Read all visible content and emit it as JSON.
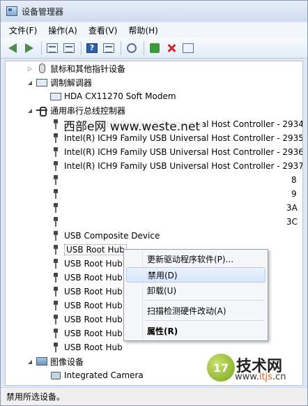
{
  "window": {
    "title": "设备管理器"
  },
  "menu": [
    "文件(F)",
    "操作(A)",
    "查看(V)",
    "帮助(H)"
  ],
  "toolbar": {
    "icons": [
      "back-arrow-icon",
      "forward-arrow-icon",
      "properties-icon",
      "refresh-icon",
      "help-icon",
      "view-icon",
      "scan-hardware-icon",
      "update-driver-icon",
      "uninstall-icon",
      "disable-icon"
    ],
    "help_glyph": "?"
  },
  "tree": {
    "mice_category": "鼠标和其他指针设备",
    "modem_category": "调制解调器",
    "modem_device": "HDA CX11270 Soft Modem",
    "usb_category": "通用串行总线控制器",
    "usb_devices": [
      "Intel(R) ICH9 Family USB Universal Host Controller - 2934",
      "Intel(R) ICH9 Family USB Universal Host Controller - 2935",
      "Intel(R) ICH9 Family USB Universal Host Controller - 2936",
      "Intel(R) ICH9 Family USB Universal Host Controller - 2937",
      "8",
      "9",
      "3A",
      "3C",
      "USB Composite Device",
      "USB Root Hub",
      "USB Root Hub",
      "USB Root Hub",
      "USB Root Hub",
      "USB Root Hub",
      "USB Root Hub",
      "USB Root Hub",
      "USB Root Hub"
    ],
    "imaging_category": "图像设备",
    "imaging_device": "Integrated Camera"
  },
  "watermark": "西部e网 www.weste.net",
  "context_menu": {
    "update_driver": "更新驱动程序软件(P)...",
    "disable": "禁用(D)",
    "uninstall": "卸载(U)",
    "scan": "扫描检测硬件改动(A)",
    "properties": "属性(R)"
  },
  "status": "禁用所选设备。",
  "logo": {
    "mark": "17",
    "name": "技术网",
    "url_prefix": "www.",
    "url_highlight": "itjs",
    "url_suffix": ".cn"
  }
}
